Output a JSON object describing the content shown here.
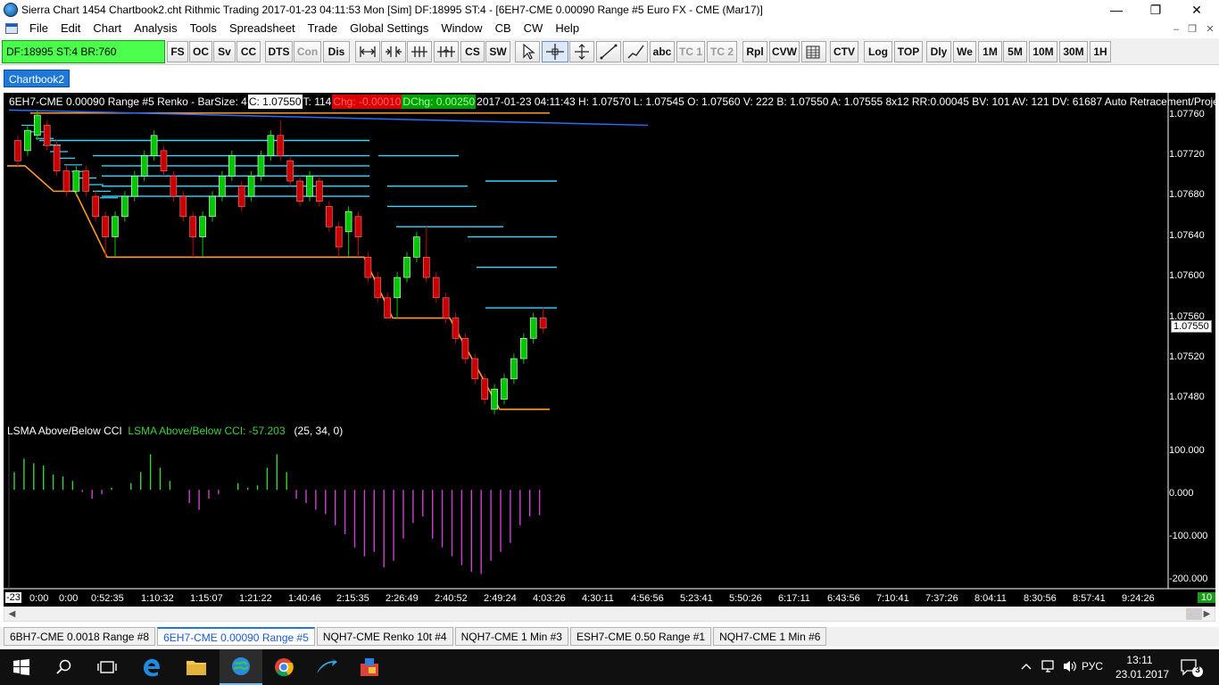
{
  "window": {
    "title": "Sierra Chart 1454 Chartbook2.cht  Rithmic Trading 2017-01-23  04:11:53 Mon [Sim]  DF:18995  ST:4 - [6EH7-CME  0.00090 Range  #5  Euro FX - CME (Mar17)]",
    "minimize": "—",
    "restore": "❐",
    "close": "✕"
  },
  "menu": [
    "File",
    "Edit",
    "Chart",
    "Analysis",
    "Tools",
    "Spreadsheet",
    "Trade",
    "Global Settings",
    "Window",
    "CB",
    "CW",
    "Help"
  ],
  "mdi": {
    "minimize": "–",
    "restore": "❐",
    "close": "✕"
  },
  "toolbar": {
    "status": "DF:18995  ST:4  BR:760",
    "buttons": [
      "FS",
      "OC",
      "Sv",
      "CC",
      "DTS",
      "Con",
      "Dis",
      "CS",
      "SW",
      "abc",
      "TC 1",
      "TC 2",
      "Rpl",
      "CVW",
      "CTV",
      "Log",
      "TOP",
      "Dly",
      "We",
      "1M",
      "5M",
      "10M",
      "30M",
      "1H"
    ]
  },
  "chartbook_tab": "Chartbook2",
  "infobar": {
    "symbol": "6EH7-CME  0.00090 Range  #5 Renko - BarSize: 4",
    "close": "C: 1.07550",
    "trades": "T: 114",
    "chg": "Chg: -0.00010",
    "dchg": "DChg: 0.00250",
    "rest": "2017-01-23 04:11:43 H: 1.07570  L: 1.07545  O: 1.07560  V: 222  B: 1.07550  A: 1.07555  8x12  RR:0.00045  BV: 101  AV: 121  DV: 61687  Auto Retracement/Projection"
  },
  "study": {
    "name": "LSMA Above/Below CCI",
    "value_label": "LSMA Above/Below CCI: -57.203",
    "params": "(25, 34, 0)"
  },
  "price_axis": [
    "1.07760",
    "1.07720",
    "1.07680",
    "1.07640",
    "1.07600",
    "1.07560",
    "1.07520",
    "1.07480"
  ],
  "current_price": "1.07550",
  "cci_axis": [
    "100.000",
    "0.000",
    "-100.000",
    "-200.000"
  ],
  "time_axis": [
    "0:00",
    "0:00",
    "0:52:35",
    "1:10:32",
    "1:15:07",
    "1:21:22",
    "1:40:46",
    "2:15:35",
    "2:26:49",
    "2:40:52",
    "2:49:24",
    "4:03:26",
    "4:30:11",
    "4:56:56",
    "5:23:41",
    "5:50:26",
    "6:17:11",
    "6:43:56",
    "7:10:41",
    "7:37:26",
    "8:04:11",
    "8:30:56",
    "8:57:41",
    "9:24:26"
  ],
  "time_axis_first": "-23",
  "time_axis_count": "10",
  "colors": {
    "up": "#00c800",
    "down": "#c80000",
    "zigzag": "#ff9a2a",
    "level": "#33d8ff",
    "ema": "#2a6cff",
    "cci_pos": "#3ed13e",
    "cci_neg": "#d040d0"
  },
  "chart_data": {
    "type": "candlestick",
    "candles": [
      {
        "o": 1.07735,
        "c": 1.07715,
        "h": 1.0774,
        "l": 1.0771
      },
      {
        "o": 1.07725,
        "c": 1.07745,
        "h": 1.0775,
        "l": 1.0772
      },
      {
        "o": 1.0774,
        "c": 1.0776,
        "h": 1.07765,
        "l": 1.07735
      },
      {
        "o": 1.0775,
        "c": 1.0773,
        "h": 1.07755,
        "l": 1.07725
      },
      {
        "o": 1.0773,
        "c": 1.07705,
        "h": 1.07735,
        "l": 1.077
      },
      {
        "o": 1.07705,
        "c": 1.07685,
        "h": 1.0771,
        "l": 1.0768
      },
      {
        "o": 1.07685,
        "c": 1.07705,
        "h": 1.0771,
        "l": 1.0768
      },
      {
        "o": 1.07705,
        "c": 1.07685,
        "h": 1.0771,
        "l": 1.0768
      },
      {
        "o": 1.0768,
        "c": 1.0766,
        "h": 1.07685,
        "l": 1.07655
      },
      {
        "o": 1.0766,
        "c": 1.0764,
        "h": 1.07665,
        "l": 1.0762
      },
      {
        "o": 1.0764,
        "c": 1.0766,
        "h": 1.07665,
        "l": 1.0762
      },
      {
        "o": 1.0766,
        "c": 1.0768,
        "h": 1.07685,
        "l": 1.07655
      },
      {
        "o": 1.0768,
        "c": 1.077,
        "h": 1.07705,
        "l": 1.07675
      },
      {
        "o": 1.077,
        "c": 1.0772,
        "h": 1.07725,
        "l": 1.07695
      },
      {
        "o": 1.0772,
        "c": 1.0774,
        "h": 1.07745,
        "l": 1.07715
      },
      {
        "o": 1.07725,
        "c": 1.07705,
        "h": 1.0773,
        "l": 1.077
      },
      {
        "o": 1.077,
        "c": 1.0768,
        "h": 1.07705,
        "l": 1.07675
      },
      {
        "o": 1.0768,
        "c": 1.0766,
        "h": 1.07685,
        "l": 1.07655
      },
      {
        "o": 1.0766,
        "c": 1.0764,
        "h": 1.07665,
        "l": 1.0762
      },
      {
        "o": 1.0764,
        "c": 1.0766,
        "h": 1.07665,
        "l": 1.0762
      },
      {
        "o": 1.0766,
        "c": 1.0768,
        "h": 1.07685,
        "l": 1.07655
      },
      {
        "o": 1.0768,
        "c": 1.077,
        "h": 1.07705,
        "l": 1.07675
      },
      {
        "o": 1.077,
        "c": 1.0772,
        "h": 1.07725,
        "l": 1.07695
      },
      {
        "o": 1.0769,
        "c": 1.0767,
        "h": 1.07695,
        "l": 1.07665
      },
      {
        "o": 1.0768,
        "c": 1.077,
        "h": 1.07705,
        "l": 1.07675
      },
      {
        "o": 1.077,
        "c": 1.0772,
        "h": 1.07725,
        "l": 1.07695
      },
      {
        "o": 1.0772,
        "c": 1.0774,
        "h": 1.07745,
        "l": 1.07715
      },
      {
        "o": 1.0774,
        "c": 1.0772,
        "h": 1.07755,
        "l": 1.07715
      },
      {
        "o": 1.07715,
        "c": 1.07695,
        "h": 1.0772,
        "l": 1.0769
      },
      {
        "o": 1.07695,
        "c": 1.07675,
        "h": 1.077,
        "l": 1.0767
      },
      {
        "o": 1.0768,
        "c": 1.077,
        "h": 1.07705,
        "l": 1.07675
      },
      {
        "o": 1.07695,
        "c": 1.07675,
        "h": 1.077,
        "l": 1.0767
      },
      {
        "o": 1.0767,
        "c": 1.0765,
        "h": 1.07675,
        "l": 1.07645
      },
      {
        "o": 1.0765,
        "c": 1.0763,
        "h": 1.07655,
        "l": 1.0762
      },
      {
        "o": 1.07645,
        "c": 1.07665,
        "h": 1.0767,
        "l": 1.0762
      },
      {
        "o": 1.0766,
        "c": 1.0764,
        "h": 1.07665,
        "l": 1.0762
      },
      {
        "o": 1.0762,
        "c": 1.076,
        "h": 1.07625,
        "l": 1.07595
      },
      {
        "o": 1.076,
        "c": 1.0758,
        "h": 1.07605,
        "l": 1.07575
      },
      {
        "o": 1.0758,
        "c": 1.0756,
        "h": 1.07585,
        "l": 1.0756
      },
      {
        "o": 1.0758,
        "c": 1.076,
        "h": 1.07605,
        "l": 1.0756
      },
      {
        "o": 1.076,
        "c": 1.0762,
        "h": 1.07625,
        "l": 1.07595
      },
      {
        "o": 1.0762,
        "c": 1.0764,
        "h": 1.07645,
        "l": 1.07615
      },
      {
        "o": 1.0762,
        "c": 1.076,
        "h": 1.0765,
        "l": 1.07595
      },
      {
        "o": 1.076,
        "c": 1.0758,
        "h": 1.07605,
        "l": 1.07575
      },
      {
        "o": 1.0758,
        "c": 1.0756,
        "h": 1.07585,
        "l": 1.07555
      },
      {
        "o": 1.0756,
        "c": 1.0754,
        "h": 1.07565,
        "l": 1.07535
      },
      {
        "o": 1.0754,
        "c": 1.0752,
        "h": 1.07545,
        "l": 1.07515
      },
      {
        "o": 1.0752,
        "c": 1.075,
        "h": 1.07525,
        "l": 1.07495
      },
      {
        "o": 1.075,
        "c": 1.0748,
        "h": 1.07505,
        "l": 1.07475
      },
      {
        "o": 1.0747,
        "c": 1.0749,
        "h": 1.07495,
        "l": 1.07465
      },
      {
        "o": 1.0748,
        "c": 1.075,
        "h": 1.07505,
        "l": 1.07475
      },
      {
        "o": 1.075,
        "c": 1.0752,
        "h": 1.07525,
        "l": 1.07495
      },
      {
        "o": 1.0752,
        "c": 1.0754,
        "h": 1.07545,
        "l": 1.07515
      },
      {
        "o": 1.0754,
        "c": 1.0756,
        "h": 1.07565,
        "l": 1.07535
      },
      {
        "o": 1.0756,
        "c": 1.0755,
        "h": 1.0757,
        "l": 1.07545
      }
    ],
    "cci": [
      40,
      70,
      60,
      55,
      35,
      30,
      20,
      -5,
      -20,
      -10,
      5,
      0,
      15,
      40,
      80,
      50,
      20,
      0,
      -30,
      -45,
      -20,
      -10,
      0,
      15,
      5,
      10,
      50,
      80,
      40,
      -20,
      -30,
      -45,
      -55,
      -80,
      -100,
      -130,
      -150,
      -140,
      -175,
      -160,
      -110,
      -75,
      -60,
      -110,
      -130,
      -150,
      -170,
      -185,
      -190,
      -160,
      -140,
      -120,
      -80,
      -60,
      -57.203
    ],
    "ylim": [
      1.07455,
      1.07775
    ],
    "cci_ylim": [
      -215,
      115
    ]
  }
}
